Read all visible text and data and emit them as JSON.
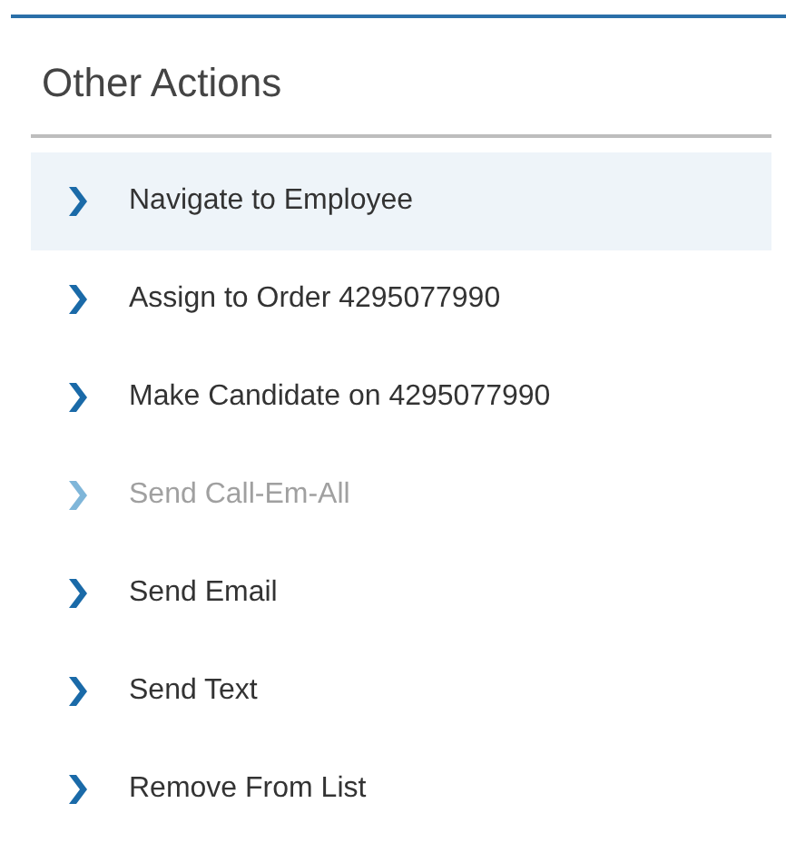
{
  "panel": {
    "title": "Other Actions"
  },
  "actions": [
    {
      "label": "Navigate to Employee",
      "selected": true,
      "disabled": false
    },
    {
      "label": "Assign to Order 4295077990",
      "selected": false,
      "disabled": false
    },
    {
      "label": "Make Candidate on 4295077990",
      "selected": false,
      "disabled": false
    },
    {
      "label": "Send Call-Em-All",
      "selected": false,
      "disabled": true
    },
    {
      "label": "Send Email",
      "selected": false,
      "disabled": false
    },
    {
      "label": "Send Text",
      "selected": false,
      "disabled": false
    },
    {
      "label": "Remove From List",
      "selected": false,
      "disabled": false
    }
  ]
}
